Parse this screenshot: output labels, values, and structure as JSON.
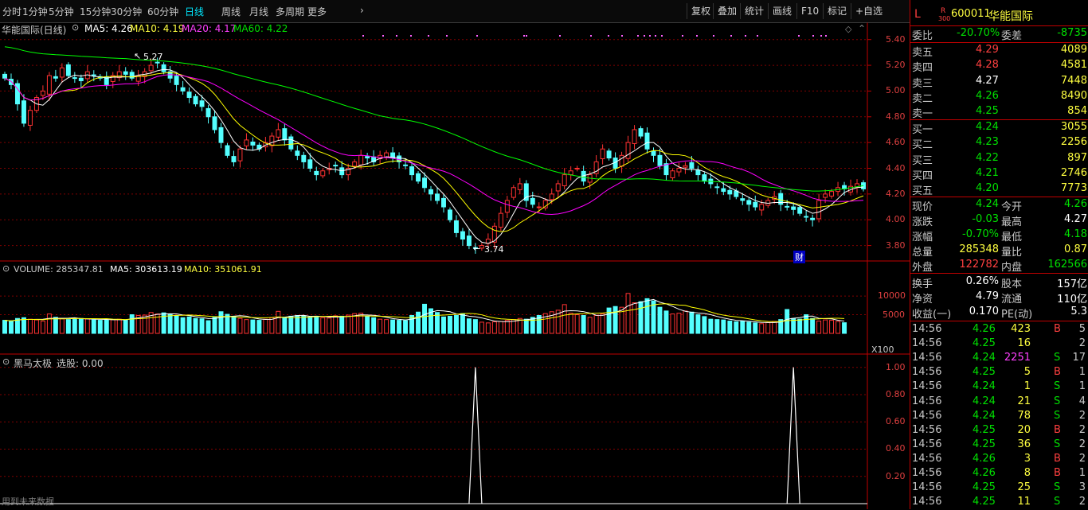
{
  "toolbar": {
    "periods": [
      "分时",
      "1分钟",
      "5分钟",
      "15分钟",
      "30分钟",
      "60分钟",
      "日线",
      "周线",
      "月线",
      "多周期",
      "更多"
    ],
    "active_period": "日线",
    "buttons": [
      "复权",
      "叠加",
      "统计",
      "画线",
      "F10",
      "标记",
      "+自选"
    ]
  },
  "price_pane": {
    "title": "华能国际(日线)",
    "ma5": "MA5: 4.26",
    "ma10": "MA10: 4.19",
    "ma20": "MA20: 4.17",
    "ma60": "MA60: 4.22",
    "high_label": "5.27",
    "low_label": "3.74",
    "fin_badge": "财",
    "yticks": [
      "5.40",
      "5.20",
      "5.00",
      "4.80",
      "4.60",
      "4.40",
      "4.20",
      "4.00",
      "3.80"
    ]
  },
  "volume_pane": {
    "title": "VOLUME: 285347.81",
    "ma5": "MA5: 303613.19",
    "ma10": "MA10: 351061.91",
    "yticks": [
      "10000",
      "5000"
    ],
    "unit": "X100"
  },
  "indicator_pane": {
    "title": "黑马太极",
    "value": "选股: 0.00",
    "yticks": [
      "1.00",
      "0.80",
      "0.60",
      "0.40",
      "0.20"
    ],
    "footer": "用到未来数据"
  },
  "quote": {
    "market_flag": "L",
    "code": "600011",
    "name": "华能国际",
    "r_badge": "R",
    "r_num": "300",
    "weibi_label": "委比",
    "weibi": "-20.70%",
    "weicha_label": "委差",
    "weicha": "-8735",
    "asks": [
      {
        "label": "卖五",
        "price": "4.29",
        "vol": "4089",
        "color": "red"
      },
      {
        "label": "卖四",
        "price": "4.28",
        "vol": "4581",
        "color": "red"
      },
      {
        "label": "卖三",
        "price": "4.27",
        "vol": "7448",
        "color": "white"
      },
      {
        "label": "卖二",
        "price": "4.26",
        "vol": "8490",
        "color": "green"
      },
      {
        "label": "卖一",
        "price": "4.25",
        "vol": "854",
        "color": "green"
      }
    ],
    "bids": [
      {
        "label": "买一",
        "price": "4.24",
        "vol": "3055",
        "color": "green"
      },
      {
        "label": "买二",
        "price": "4.23",
        "vol": "2256",
        "color": "green"
      },
      {
        "label": "买三",
        "price": "4.22",
        "vol": "897",
        "color": "green"
      },
      {
        "label": "买四",
        "price": "4.21",
        "vol": "2746",
        "color": "green"
      },
      {
        "label": "买五",
        "price": "4.20",
        "vol": "7773",
        "color": "green"
      }
    ],
    "stats": [
      {
        "l1": "现价",
        "v1": "4.24",
        "c1": "green",
        "l2": "今开",
        "v2": "4.26",
        "c2": "green"
      },
      {
        "l1": "涨跌",
        "v1": "-0.03",
        "c1": "green",
        "l2": "最高",
        "v2": "4.27",
        "c2": "white"
      },
      {
        "l1": "涨幅",
        "v1": "-0.70%",
        "c1": "green",
        "l2": "最低",
        "v2": "4.18",
        "c2": "green"
      },
      {
        "l1": "总量",
        "v1": "285348",
        "c1": "yellow",
        "l2": "量比",
        "v2": "0.87",
        "c2": "yellow"
      },
      {
        "l1": "外盘",
        "v1": "122782",
        "c1": "red",
        "l2": "内盘",
        "v2": "162566",
        "c2": "green"
      }
    ],
    "fund": [
      {
        "l1": "换手",
        "v1": "0.26%",
        "l2": "股本",
        "v2": "157亿"
      },
      {
        "l1": "净资",
        "v1": "4.79",
        "l2": "流通",
        "v2": "110亿"
      },
      {
        "l1": "收益(一)",
        "v1": "0.170",
        "l2": "PE(动)",
        "v2": "5.3"
      }
    ],
    "ticks": [
      {
        "time": "14:56",
        "price": "4.26",
        "vol": "423",
        "bs": "B",
        "n": "5"
      },
      {
        "time": "14:56",
        "price": "4.25",
        "vol": "16",
        "bs": "",
        "n": "2"
      },
      {
        "time": "14:56",
        "price": "4.24",
        "vol": "2251",
        "bs": "S",
        "n": "17"
      },
      {
        "time": "14:56",
        "price": "4.25",
        "vol": "5",
        "bs": "B",
        "n": "1"
      },
      {
        "time": "14:56",
        "price": "4.24",
        "vol": "1",
        "bs": "S",
        "n": "1"
      },
      {
        "time": "14:56",
        "price": "4.24",
        "vol": "21",
        "bs": "S",
        "n": "4"
      },
      {
        "time": "14:56",
        "price": "4.24",
        "vol": "78",
        "bs": "S",
        "n": "2"
      },
      {
        "time": "14:56",
        "price": "4.25",
        "vol": "20",
        "bs": "B",
        "n": "2"
      },
      {
        "time": "14:56",
        "price": "4.25",
        "vol": "36",
        "bs": "S",
        "n": "2"
      },
      {
        "time": "14:56",
        "price": "4.26",
        "vol": "3",
        "bs": "B",
        "n": "2"
      },
      {
        "time": "14:56",
        "price": "4.26",
        "vol": "8",
        "bs": "B",
        "n": "1"
      },
      {
        "time": "14:56",
        "price": "4.25",
        "vol": "25",
        "bs": "S",
        "n": "3"
      },
      {
        "time": "14:56",
        "price": "4.25",
        "vol": "11",
        "bs": "S",
        "n": "2"
      }
    ]
  },
  "colors": {
    "up": "#ff3232",
    "down": "#54ffff",
    "ma5": "#ffffff",
    "ma10": "#ffff00",
    "ma20": "#ff00ff",
    "ma60": "#00ff00",
    "grid": "#800000"
  },
  "chart_data": {
    "type": "candlestick",
    "close": [
      5.1,
      5.05,
      4.9,
      4.75,
      4.85,
      4.95,
      5.0,
      5.12,
      5.1,
      5.18,
      5.12,
      5.1,
      5.08,
      5.15,
      5.12,
      5.1,
      5.05,
      5.12,
      5.15,
      5.13,
      5.1,
      5.12,
      5.15,
      5.2,
      5.22,
      5.15,
      5.1,
      5.05,
      5.0,
      4.95,
      4.9,
      4.88,
      4.8,
      4.7,
      4.6,
      4.5,
      4.45,
      4.55,
      4.62,
      4.58,
      4.55,
      4.6,
      4.65,
      4.7,
      4.62,
      4.55,
      4.5,
      4.45,
      4.4,
      4.35,
      4.38,
      4.4,
      4.42,
      4.35,
      4.4,
      4.45,
      4.5,
      4.48,
      4.45,
      4.5,
      4.52,
      4.48,
      4.45,
      4.42,
      4.35,
      4.3,
      4.25,
      4.2,
      4.15,
      4.1,
      4.0,
      3.9,
      3.85,
      3.8,
      3.78,
      3.8,
      3.85,
      3.95,
      4.05,
      4.15,
      4.25,
      4.28,
      4.15,
      4.12,
      4.1,
      4.15,
      4.2,
      4.28,
      4.35,
      4.38,
      4.4,
      4.3,
      4.35,
      4.45,
      4.55,
      4.48,
      4.4,
      4.5,
      4.6,
      4.7,
      4.65,
      4.55,
      4.5,
      4.42,
      4.35,
      4.38,
      4.4,
      4.42,
      4.4,
      4.35,
      4.3,
      4.28,
      4.25,
      4.22,
      4.2,
      4.18,
      4.15,
      4.12,
      4.1,
      4.12,
      4.15,
      4.18,
      4.12,
      4.1,
      4.08,
      4.05,
      4.02,
      4.0,
      4.15,
      4.2,
      4.22,
      4.25,
      4.24,
      4.26,
      4.28,
      4.24
    ],
    "volume": [
      3500,
      3200,
      4000,
      4200,
      3800,
      3600,
      3300,
      5200,
      4300,
      3900,
      3700,
      3800,
      4000,
      3900,
      3600,
      3500,
      3600,
      3700,
      3800,
      3500,
      5000,
      4800,
      4900,
      5600,
      5200,
      5500,
      5100,
      4700,
      4200,
      4400,
      4000,
      3900,
      3400,
      4300,
      5800,
      5100,
      4500,
      4000,
      3700,
      3600,
      3500,
      3800,
      4200,
      5900,
      4300,
      4600,
      4800,
      4700,
      4400,
      4500,
      4200,
      4100,
      4700,
      4600,
      4900,
      5300,
      5400,
      4500,
      4200,
      3800,
      3700,
      3600,
      3500,
      3400,
      4800,
      5700,
      7800,
      6600,
      5600,
      4400,
      4600,
      4800,
      5300,
      3900,
      3700,
      3000,
      2800,
      3100,
      3200,
      3500,
      3700,
      4000,
      3800,
      4300,
      4800,
      5300,
      5800,
      6200,
      7700,
      5400,
      5000,
      4800,
      4300,
      4800,
      5200,
      6800,
      7200,
      7000,
      10700,
      8200,
      8500,
      9300,
      8700,
      7000,
      6000,
      5200,
      5400,
      6000,
      5700,
      5000,
      4500,
      3800,
      3700,
      3600,
      3300,
      3100,
      3200,
      3000,
      2800,
      2600,
      2900,
      3200,
      3700,
      6400,
      4000,
      3800,
      5000,
      4000,
      3300,
      3600,
      3500,
      3200,
      2850
    ],
    "ylim": [
      3.68,
      5.46
    ],
    "vol_ylim": [
      0,
      13000
    ],
    "signal_ylim": [
      0,
      1.08
    ],
    "signal_at": [
      74,
      124
    ]
  }
}
